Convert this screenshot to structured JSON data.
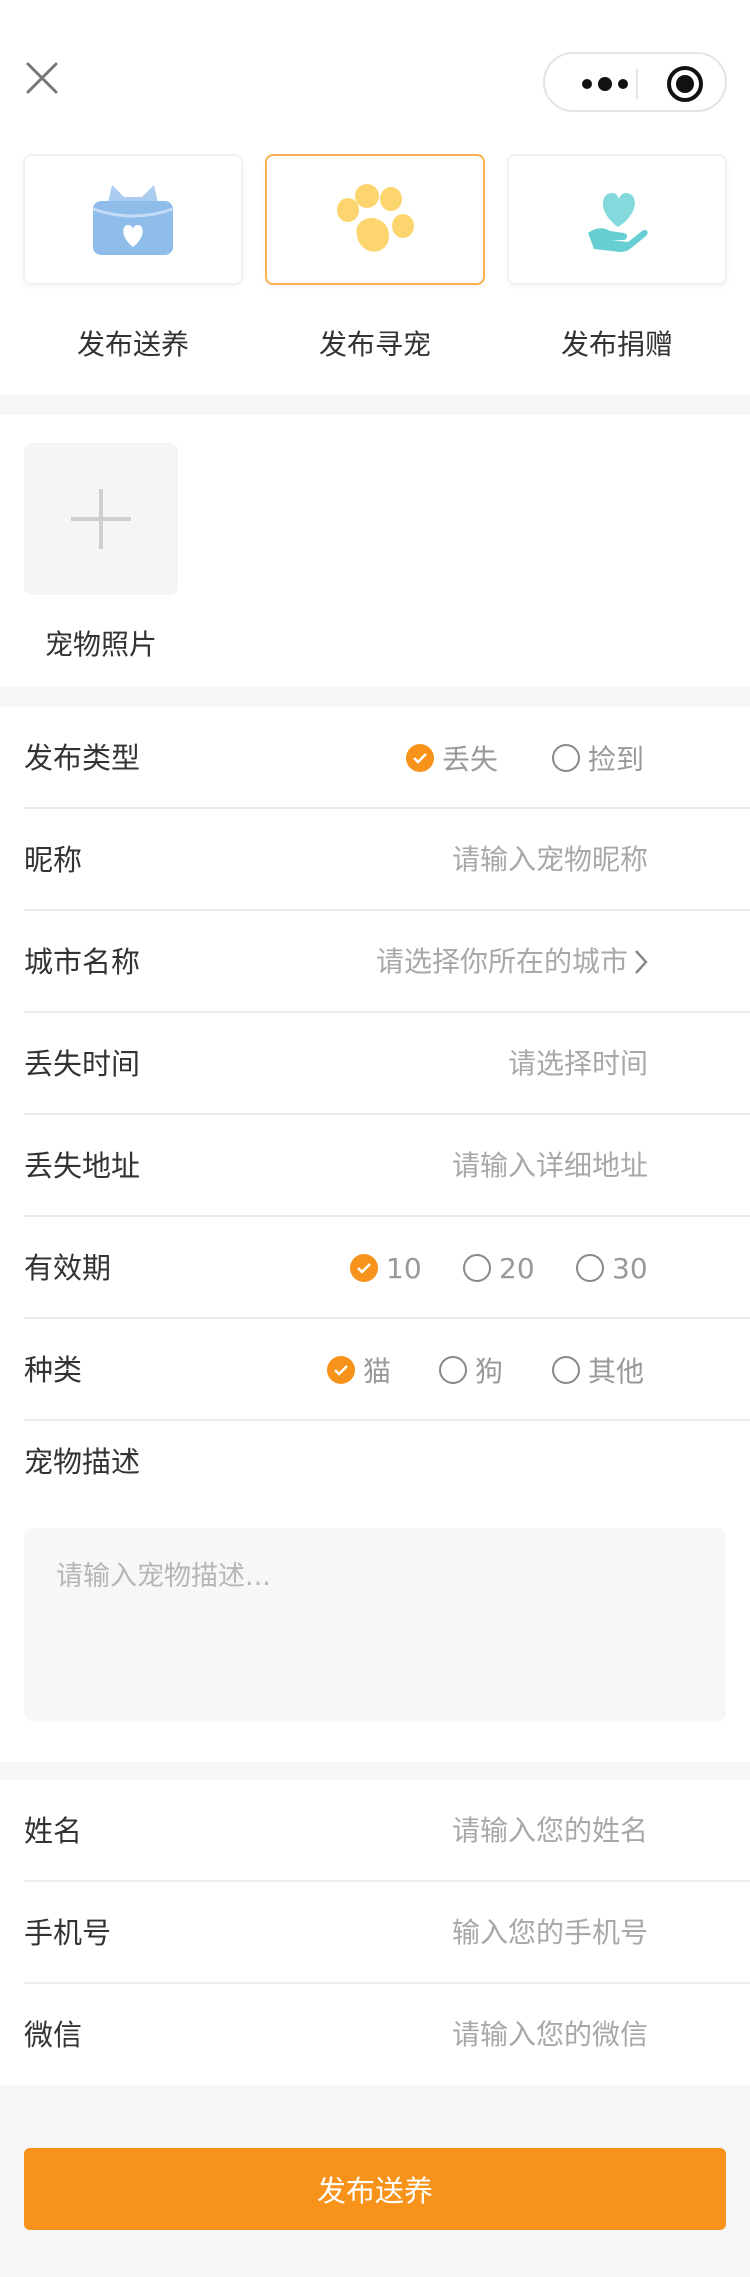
{
  "header": {
    "close_icon": "close-icon",
    "menu_icon": "more-dots-icon",
    "target_icon": "record-target-icon"
  },
  "categories": [
    {
      "label": "发布送养",
      "icon": "cat-heart-box-icon",
      "active": false
    },
    {
      "label": "发布寻宠",
      "icon": "paw-print-icon",
      "active": true
    },
    {
      "label": "发布捐赠",
      "icon": "heart-hand-icon",
      "active": false
    }
  ],
  "photo": {
    "label": "宠物照片",
    "icon": "plus-icon"
  },
  "form": {
    "publish_type": {
      "label": "发布类型",
      "options": [
        "丢失",
        "捡到"
      ],
      "selected": "丢失"
    },
    "nickname": {
      "label": "昵称",
      "placeholder": "请输入宠物昵称"
    },
    "city": {
      "label": "城市名称",
      "placeholder": "请选择你所在的城市"
    },
    "lost_time": {
      "label": "丢失时间",
      "placeholder": "请选择时间"
    },
    "lost_address": {
      "label": "丢失地址",
      "placeholder": "请输入详细地址"
    },
    "validity": {
      "label": "有效期",
      "options": [
        "10",
        "20",
        "30"
      ],
      "selected": "10"
    },
    "species": {
      "label": "种类",
      "options": [
        "猫",
        "狗",
        "其他"
      ],
      "selected": "猫"
    },
    "description": {
      "label": "宠物描述",
      "placeholder": "请输入宠物描述..."
    }
  },
  "contact": {
    "name": {
      "label": "姓名",
      "placeholder": "请输入您的姓名"
    },
    "phone": {
      "label": "手机号",
      "placeholder": "输入您的手机号"
    },
    "wechat": {
      "label": "微信",
      "placeholder": "请输入您的微信"
    }
  },
  "submit_label": "发布送养",
  "colors": {
    "accent": "#f7931a",
    "active_border": "#f7b14e",
    "placeholder": "#a8a8a8"
  }
}
